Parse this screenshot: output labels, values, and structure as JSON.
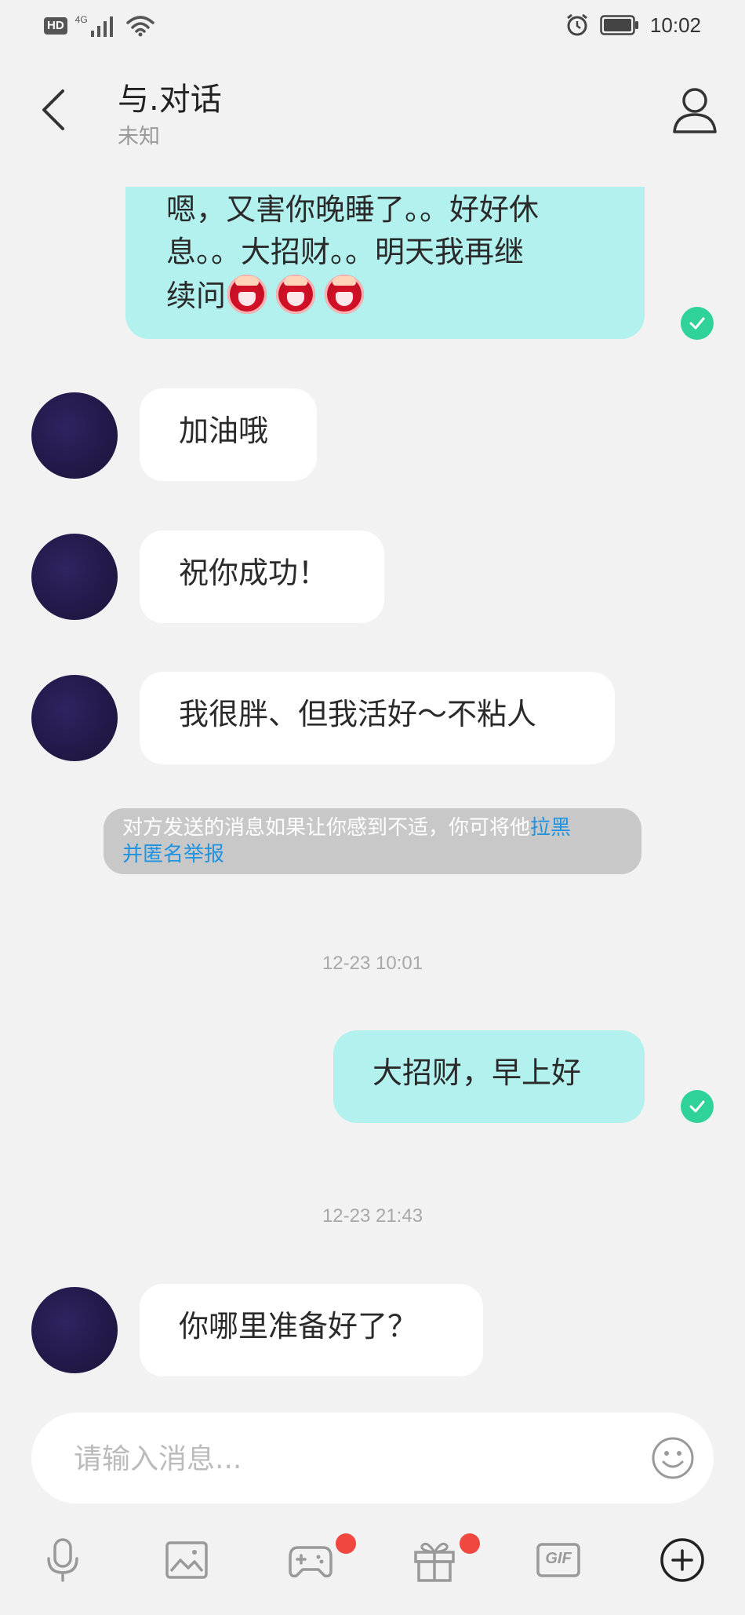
{
  "status_bar": {
    "hd_label": "HD",
    "network_label": "4G",
    "time": "10:02"
  },
  "header": {
    "title": "与.对话",
    "subtitle": "未知"
  },
  "messages": [
    {
      "direction": "out",
      "text": "嗯，又害你晚睡了。。好好休息。。大招财。。明天我再继续问",
      "line1": "嗯，又害你晚睡了。。好好休",
      "line2": "息。。大招财。。明天我再继",
      "line3": "续问",
      "emoji_count": 3,
      "status": "read"
    },
    {
      "direction": "in",
      "text": "加油哦"
    },
    {
      "direction": "in",
      "text": "祝你成功！"
    },
    {
      "direction": "in",
      "text": "我很胖、但我活好～不粘人"
    },
    {
      "direction": "out",
      "text": "大招财，早上好",
      "status": "read"
    },
    {
      "direction": "in",
      "text": "你哪里准备好了？"
    }
  ],
  "notice": {
    "text": "对方发送的消息如果让你感到不适，你可将他",
    "link_text": "拉黑并匿名举报",
    "link_line1": "拉黑",
    "link_line2": "并匿名举报"
  },
  "timestamps": [
    "12-23 10:01",
    "12-23 21:43"
  ],
  "input": {
    "placeholder": "请输入消息..."
  },
  "toolbar": {
    "items": [
      "microphone-icon",
      "image-icon",
      "game-icon",
      "gift-icon",
      "gif-icon",
      "plus-icon"
    ],
    "gif_label": "GIF",
    "badges": {
      "game": true,
      "gift": true
    }
  },
  "colors": {
    "background": "#f2f2f2",
    "incoming_bubble": "#ffffff",
    "outgoing_bubble": "#b2f1ee",
    "read_check": "#2fd39a",
    "link": "#1f93e0",
    "badge": "#f0483e"
  }
}
